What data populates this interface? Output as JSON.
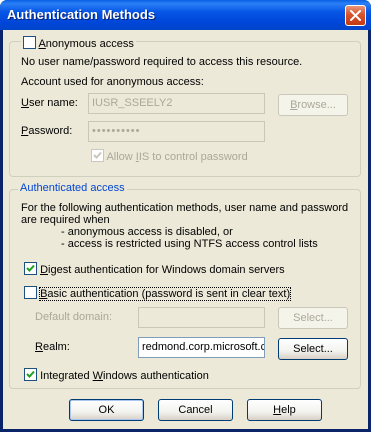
{
  "window": {
    "title": "Authentication Methods"
  },
  "anonymous": {
    "checkbox_label_u": "A",
    "checkbox_label_rest": "nonymous access",
    "checked": false,
    "info_text": "No user name/password required to access this resource.",
    "account_heading": "Account used for anonymous access:",
    "username_label_u": "U",
    "username_label_rest": "ser name:",
    "username_value": "IUSR_SSEELY2",
    "browse_label_u": "B",
    "browse_label_rest": "rowse...",
    "password_label_u": "P",
    "password_label_rest": "assword:",
    "password_value": "••••••••••",
    "allow_iis_label_u": "I",
    "allow_iis_label_pre": "Allow ",
    "allow_iis_label_rest": "IS to control password",
    "allow_iis_checked": true
  },
  "authenticated": {
    "legend": "Authenticated access",
    "description_lines": [
      "For the following authentication methods, user name and password",
      "are required when",
      "- anonymous access is disabled, or",
      "- access is restricted using NTFS access control lists"
    ],
    "digest_label_pre": "D",
    "digest_label_rest": "igest authentication for Windows domain servers",
    "digest_checked": true,
    "basic_label_pre": "",
    "basic_label_u": "B",
    "basic_label_rest": "asic authentication (password is sent in clear text)",
    "basic_checked": false,
    "default_domain_label": "Default domain:",
    "default_domain_value": "",
    "select_domain_label": "Select...",
    "realm_label_u": "R",
    "realm_label_rest": "ealm:",
    "realm_value": "redmond.corp.microsoft.c",
    "select_realm_label": "Select...",
    "integrated_label_pre": "Integrated ",
    "integrated_label_u": "W",
    "integrated_label_rest": "indows authentication",
    "integrated_checked": true
  },
  "footer": {
    "ok_label": "OK",
    "cancel_label": "Cancel",
    "help_label_u": "H",
    "help_label_rest": "elp"
  },
  "colors": {
    "title_bar": "#0054e3",
    "dialog_bg": "#ece9d8",
    "group_legend": "#0046d5",
    "checkmark": "#21a121",
    "close_button": "#d8532c"
  }
}
